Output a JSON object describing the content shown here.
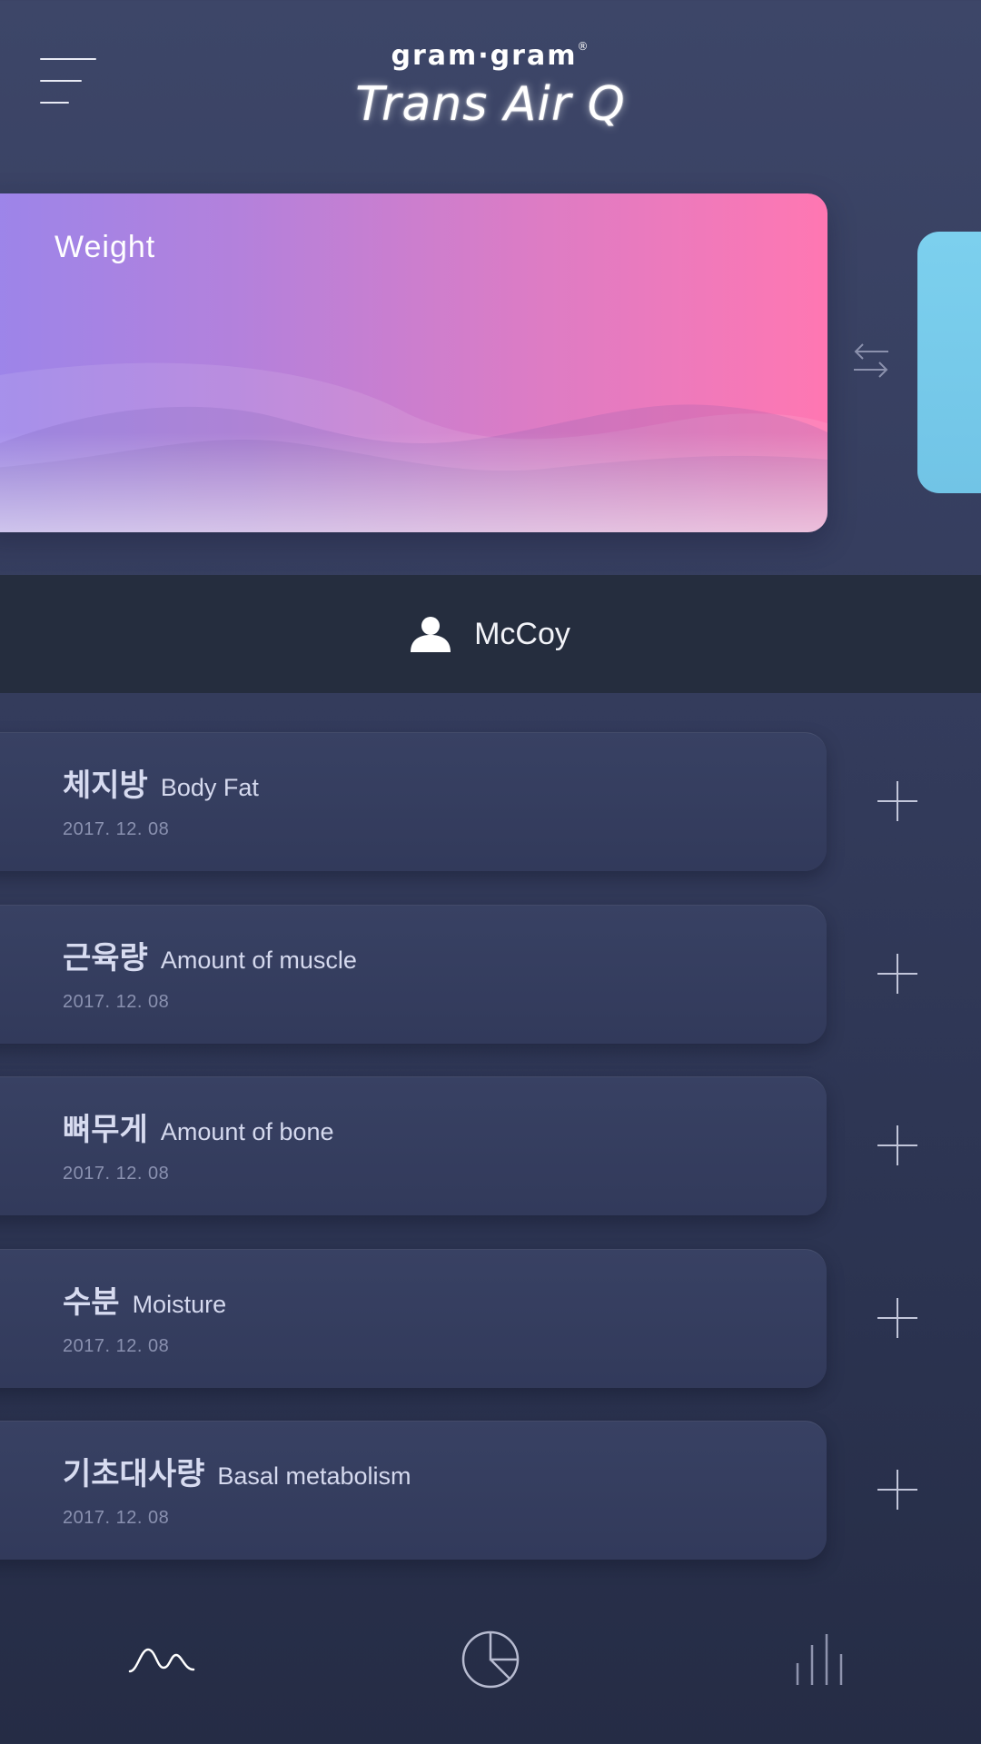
{
  "header": {
    "brand_logo": "gram·gram",
    "brand_reg": "®",
    "app_title": "Trans Air Q"
  },
  "weight_card": {
    "label": "Weight",
    "gradient_start": "#9b85ea",
    "gradient_end": "#ff77b2"
  },
  "next_card": {
    "color": "#7cd0ee"
  },
  "user": {
    "name": "McCoy",
    "icon": "person-icon"
  },
  "measurements": [
    {
      "ko": "체지방",
      "en": "Body Fat",
      "date": "2017. 12. 08"
    },
    {
      "ko": "근육량",
      "en": "Amount of muscle",
      "date": "2017. 12. 08"
    },
    {
      "ko": "뼈무게",
      "en": "Amount of bone",
      "date": "2017. 12. 08"
    },
    {
      "ko": "수분",
      "en": "Moisture",
      "date": "2017. 12. 08"
    },
    {
      "ko": "기초대사량",
      "en": "Basal metabolism",
      "date": "2017. 12. 08"
    }
  ],
  "bottom_nav": [
    {
      "icon": "wave-icon",
      "active": true
    },
    {
      "icon": "pie-chart-icon",
      "active": false
    },
    {
      "icon": "bar-chart-icon",
      "active": false
    }
  ]
}
